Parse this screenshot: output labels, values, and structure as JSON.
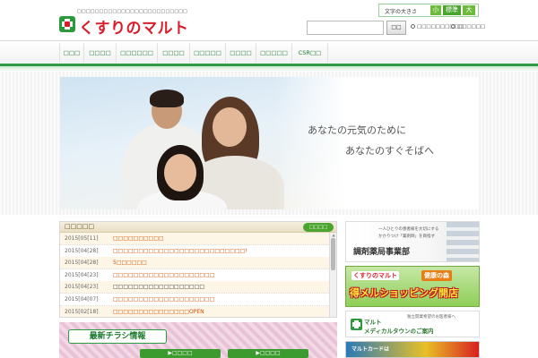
{
  "header": {
    "tagline": "□□□□□□□□□□□□□□□□□□□□□□□□□",
    "logo_text": "くすりのマルト",
    "font_size": {
      "label": "文字の大きさ",
      "small": "小",
      "medium": "標準",
      "large": "大"
    },
    "search": {
      "value": "",
      "placeholder": "",
      "button_label": "□□"
    },
    "links": [
      "□□□□□□□□□□",
      "□□□□□□"
    ]
  },
  "nav": {
    "items": [
      "□□□",
      "□□□□",
      "□□□□□□",
      "□□□□",
      "□□□□□",
      "□□□□",
      "□□□□□",
      "CSR□□"
    ]
  },
  "hero": {
    "line1": "あなたの元気のために",
    "line2": "あなたのすぐそばへ"
  },
  "news": {
    "title": "□□□□□",
    "list_button": "□□□□",
    "items": [
      {
        "date": "2015[05[11]",
        "text": "□□□□□□□□□□"
      },
      {
        "date": "2015[04[28]",
        "text": "□□□□□□□□□□□□□□□□□□□□□□□□□□!"
      },
      {
        "date": "2015[04[28]",
        "text": "5□□□□□□"
      },
      {
        "date": "2015[04[23]",
        "text": "□□□□□□□□□□□□□□□□□□□□"
      },
      {
        "date": "2015[04[23]",
        "text": "□□□□□□□□□□□□□□□□□□"
      },
      {
        "date": "2015[04[07]",
        "text": "□□□□□□□□□□□□□□□□□□□□"
      },
      {
        "date": "2015[02[18]",
        "text": "□□□□□□□□□□□□□□□OPEN"
      }
    ]
  },
  "flyer": {
    "title": "最新チラシ情報",
    "button1": "▶□□□□",
    "button2": "▶□□□□"
  },
  "banners": {
    "b1_sub1": "一人ひとりの患者様を大切にする",
    "b1_sub2": "かかりつけ「薬剤師」を目指す",
    "b1_title": "調剤薬局事業部",
    "b2_line1": "くすりのマルト",
    "b2_line1b": "健康の森",
    "b2_line2": "得メルショッピング開店",
    "b3_t1": "マルト",
    "b3_t2": "メディカルタウンのご案内",
    "b3_sub": "独立開業希望のお医者様へ",
    "b3_btn": "メディカルタウン",
    "b4_text": "マルトカードは"
  },
  "colors": {
    "brand_red": "#d81e2b",
    "brand_green": "#2f9c45",
    "news_orange": "#d24e00"
  }
}
